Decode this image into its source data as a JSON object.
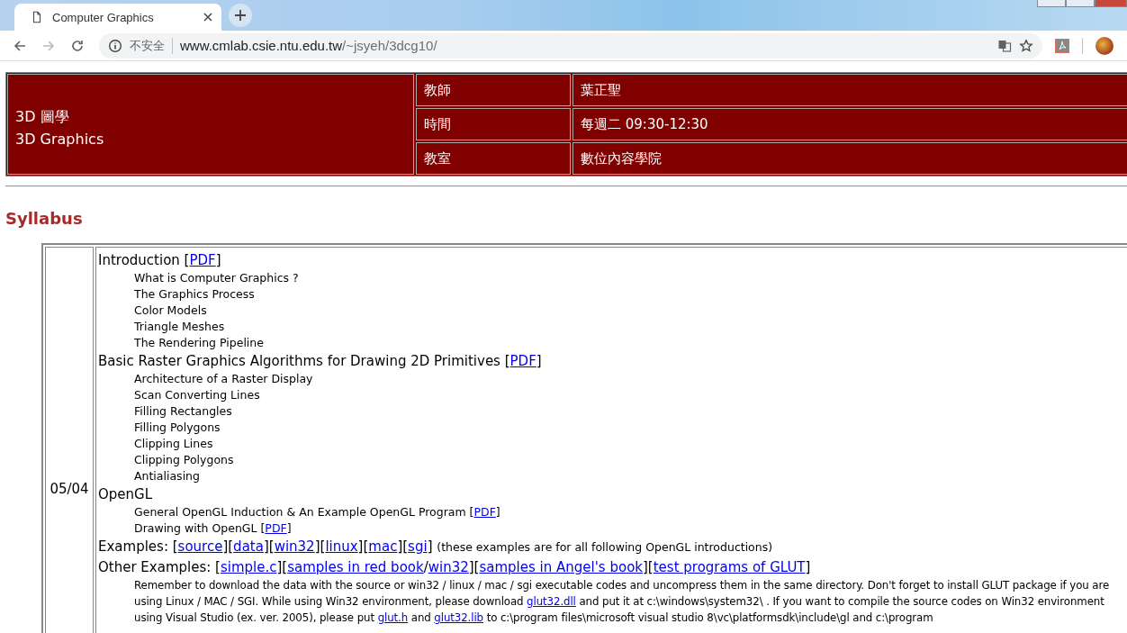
{
  "browser": {
    "tab": {
      "title": "Computer Graphics"
    },
    "forward_disabled": true,
    "address": {
      "security": "不安全",
      "host": "www.cmlab.csie.ntu.edu.tw",
      "path": "/~jsyeh/3dcg10/"
    }
  },
  "course": {
    "title_zh": "3D 圖學",
    "title_en": "3D Graphics",
    "info": [
      {
        "label": "教師",
        "value": "葉正聖"
      },
      {
        "label": "時間",
        "value": "每週二 09:30-12:30"
      },
      {
        "label": "教室",
        "value": "數位內容學院"
      }
    ]
  },
  "section_title": "Syllabus",
  "syllabus": [
    {
      "date": "05/04",
      "topics": [
        {
          "segments": [
            {
              "kind": "text",
              "text": "Introduction ["
            },
            {
              "kind": "link",
              "text": "PDF"
            },
            {
              "kind": "text",
              "text": "]"
            }
          ],
          "children": [
            {
              "kind": "item",
              "segments": [
                {
                  "kind": "text",
                  "text": "What is Computer Graphics ?"
                }
              ]
            },
            {
              "kind": "item",
              "segments": [
                {
                  "kind": "text",
                  "text": "The Graphics Process"
                }
              ]
            },
            {
              "kind": "item",
              "segments": [
                {
                  "kind": "text",
                  "text": "Color Models"
                }
              ]
            },
            {
              "kind": "item",
              "segments": [
                {
                  "kind": "text",
                  "text": "Triangle Meshes"
                }
              ]
            },
            {
              "kind": "item",
              "segments": [
                {
                  "kind": "text",
                  "text": "The Rendering Pipeline"
                }
              ]
            }
          ]
        },
        {
          "segments": [
            {
              "kind": "text",
              "text": "Basic Raster Graphics Algorithms for Drawing 2D Primitives ["
            },
            {
              "kind": "link",
              "text": "PDF"
            },
            {
              "kind": "text",
              "text": "]"
            }
          ],
          "children": [
            {
              "kind": "item",
              "segments": [
                {
                  "kind": "text",
                  "text": "Architecture of a Raster Display"
                }
              ]
            },
            {
              "kind": "item",
              "segments": [
                {
                  "kind": "text",
                  "text": "Scan Converting Lines"
                }
              ]
            },
            {
              "kind": "item",
              "segments": [
                {
                  "kind": "text",
                  "text": "Filling Rectangles"
                }
              ]
            },
            {
              "kind": "item",
              "segments": [
                {
                  "kind": "text",
                  "text": "Filling Polygons"
                }
              ]
            },
            {
              "kind": "item",
              "segments": [
                {
                  "kind": "text",
                  "text": "Clipping Lines"
                }
              ]
            },
            {
              "kind": "item",
              "segments": [
                {
                  "kind": "text",
                  "text": "Clipping Polygons"
                }
              ]
            },
            {
              "kind": "item",
              "segments": [
                {
                  "kind": "text",
                  "text": "Antialiasing"
                }
              ]
            }
          ]
        },
        {
          "segments": [
            {
              "kind": "text",
              "text": "OpenGL"
            }
          ],
          "children": [
            {
              "kind": "item",
              "segments": [
                {
                  "kind": "text",
                  "text": "General OpenGL Induction & An Example OpenGL Program ["
                },
                {
                  "kind": "link",
                  "text": "PDF"
                },
                {
                  "kind": "text",
                  "text": "]"
                }
              ]
            },
            {
              "kind": "item",
              "segments": [
                {
                  "kind": "text",
                  "text": "Drawing with OpenGL ["
                },
                {
                  "kind": "link",
                  "text": "PDF"
                },
                {
                  "kind": "text",
                  "text": "]"
                }
              ]
            }
          ]
        },
        {
          "segments": [
            {
              "kind": "text",
              "text": "Examples: ["
            },
            {
              "kind": "link",
              "text": "source"
            },
            {
              "kind": "text",
              "text": "]["
            },
            {
              "kind": "link",
              "text": "data"
            },
            {
              "kind": "text",
              "text": "]["
            },
            {
              "kind": "link",
              "text": "win32"
            },
            {
              "kind": "text",
              "text": "]["
            },
            {
              "kind": "link",
              "text": "linux"
            },
            {
              "kind": "text",
              "text": "]["
            },
            {
              "kind": "link",
              "text": "mac"
            },
            {
              "kind": "text",
              "text": "]["
            },
            {
              "kind": "link",
              "text": "sgi"
            },
            {
              "kind": "text",
              "text": "] "
            },
            {
              "kind": "note",
              "text": "(these examples are for all following OpenGL introductions)"
            }
          ]
        },
        {
          "segments": [
            {
              "kind": "text",
              "text": "Other Examples: ["
            },
            {
              "kind": "link",
              "text": "simple.c"
            },
            {
              "kind": "text",
              "text": "]["
            },
            {
              "kind": "link",
              "text": "samples in red book"
            },
            {
              "kind": "text",
              "text": "/"
            },
            {
              "kind": "link",
              "text": "win32"
            },
            {
              "kind": "text",
              "text": "]["
            },
            {
              "kind": "link",
              "text": "samples in Angel's book"
            },
            {
              "kind": "text",
              "text": "]["
            },
            {
              "kind": "link",
              "text": "test programs of GLUT"
            },
            {
              "kind": "text",
              "text": "]"
            }
          ],
          "children": [
            {
              "kind": "paragraph",
              "segments": [
                {
                  "kind": "text",
                  "text": "Remember to download the data with the source or win32 / linux / mac / sgi executable codes and uncompress them in the same directory. Don't forget to install GLUT package if you are using Linux / MAC / SGI. While using Win32 environment, please download "
                },
                {
                  "kind": "link",
                  "text": "glut32.dll"
                },
                {
                  "kind": "text",
                  "text": " and put it at c:\\windows\\system32\\ . If you want to compile the source codes on Win32 environment using Visual Studio (ex. ver. 2005), please put "
                },
                {
                  "kind": "link",
                  "text": "glut.h"
                },
                {
                  "kind": "text",
                  "text": " and "
                },
                {
                  "kind": "link",
                  "text": "glut32.lib"
                },
                {
                  "kind": "text",
                  "text": " to c:\\program files\\microsoft visual studio 8\\vc\\platformsdk\\include\\gl and c:\\program"
                }
              ]
            }
          ]
        }
      ]
    }
  ]
}
